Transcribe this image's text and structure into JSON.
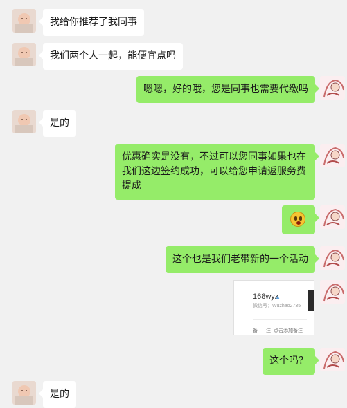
{
  "messages": [
    {
      "side": "left",
      "text": "我给你推荐了我同事"
    },
    {
      "side": "left",
      "text": "我们两个人一起，能便宜点吗"
    },
    {
      "side": "right",
      "text": "嗯嗯，好的哦，您是同事也需要代缴吗"
    },
    {
      "side": "left",
      "text": "是的"
    },
    {
      "side": "right",
      "lines": [
        "优惠确实是没有，不过可以您同事如果也在",
        "我们这边签约成功，可以给您申请返服务费",
        "提成"
      ]
    },
    {
      "side": "right",
      "emoji": "shy-smile"
    },
    {
      "side": "right",
      "text": "这个也是我们老带新的一个活动"
    },
    {
      "side": "right",
      "card": {
        "name": "168wyz",
        "wechat_id": "微信号：Wuzhao2735",
        "remark_label1": "备",
        "remark_label2": "注",
        "remark_value": "点击添加备注"
      }
    },
    {
      "side": "right",
      "text": "这个吗？"
    },
    {
      "side": "left",
      "text": "是的"
    }
  ],
  "colors": {
    "background": "#f1f1f1",
    "incoming_bubble": "#ffffff",
    "outgoing_bubble": "#95ec69"
  },
  "icons": {
    "left_avatar": "baby-photo-avatar",
    "right_avatar": "cartoon-character-avatar",
    "card_person": "person-icon"
  }
}
